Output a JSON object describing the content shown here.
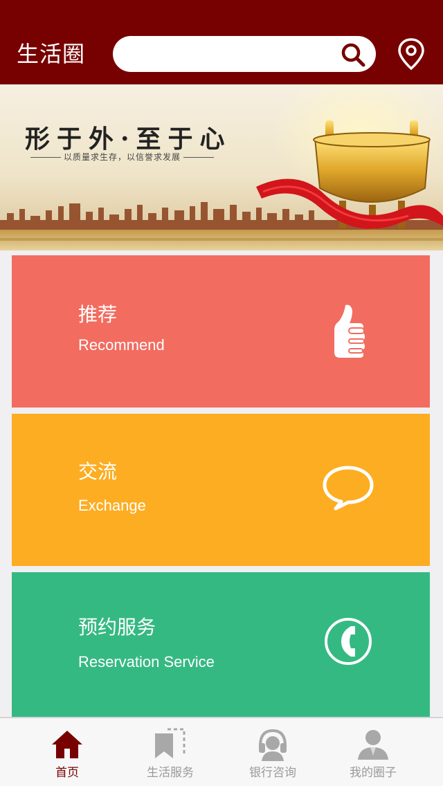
{
  "header": {
    "title": "生活圈",
    "search_placeholder": "",
    "search_value": ""
  },
  "banner": {
    "headline": "形于外·至于心",
    "subline": "以质量求生存，以信誉求发展"
  },
  "cards": [
    {
      "title": "推荐",
      "subtitle": "Recommend",
      "icon": "thumbs-up-icon",
      "color": "#f26c60"
    },
    {
      "title": "交流",
      "subtitle": "Exchange",
      "icon": "chat-bubble-icon",
      "color": "#fdad22"
    },
    {
      "title": "预约服务",
      "subtitle": "Reservation Service",
      "icon": "phone-icon",
      "color": "#35b982"
    }
  ],
  "tabs": [
    {
      "label": "首页",
      "icon": "home-icon",
      "active": true
    },
    {
      "label": "生活服务",
      "icon": "bookmark-icon",
      "active": false
    },
    {
      "label": "银行咨询",
      "icon": "headset-icon",
      "active": false
    },
    {
      "label": "我的圈子",
      "icon": "user-icon",
      "active": false
    }
  ],
  "colors": {
    "header_bg": "#770000",
    "active_tab": "#770000",
    "inactive_tab": "#9a9a9a"
  }
}
